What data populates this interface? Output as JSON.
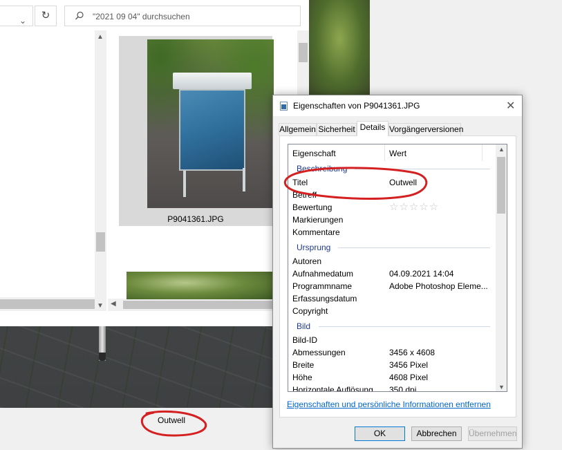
{
  "explorer": {
    "search_placeholder": "\"2021 09 04\" durchsuchen",
    "refresh_glyph": "↻",
    "chevron_glyph": "⌄",
    "thumbnail_caption": "P9041361.JPG"
  },
  "background_caption": "Outwell",
  "dialog": {
    "title": "Eigenschaften von P9041361.JPG",
    "close_glyph": "✕",
    "tabs": [
      {
        "label": "Allgemein"
      },
      {
        "label": "Sicherheit"
      },
      {
        "label": "Details"
      },
      {
        "label": "Vorgängerversionen"
      }
    ],
    "active_tab": "Details",
    "columns": {
      "property": "Eigenschaft",
      "value": "Wert"
    },
    "groups": {
      "description": "Beschreibung",
      "origin": "Ursprung",
      "image": "Bild"
    },
    "rows": {
      "titel": {
        "label": "Titel",
        "value": "Outwell"
      },
      "betreff": {
        "label": "Betreff"
      },
      "bewertung": {
        "label": "Bewertung",
        "stars": "☆☆☆☆☆",
        "rating": 0
      },
      "markierungen": {
        "label": "Markierungen"
      },
      "kommentare": {
        "label": "Kommentare"
      },
      "autoren": {
        "label": "Autoren"
      },
      "aufnahmedatum": {
        "label": "Aufnahmedatum",
        "value": "04.09.2021 14:04"
      },
      "programmname": {
        "label": "Programmname",
        "value": "Adobe Photoshop Eleme..."
      },
      "erfassungsdatum": {
        "label": "Erfassungsdatum"
      },
      "copyright": {
        "label": "Copyright"
      },
      "bild_id": {
        "label": "Bild-ID"
      },
      "abmessungen": {
        "label": "Abmessungen",
        "value": "3456 x 4608"
      },
      "breite": {
        "label": "Breite",
        "value": "3456 Pixel"
      },
      "hoehe": {
        "label": "Höhe",
        "value": "4608 Pixel"
      },
      "horizontale": {
        "label": "Horizontale Auflösung",
        "value": "350 dpi"
      }
    },
    "remove_link": "Eigenschaften und persönliche Informationen entfernen",
    "buttons": {
      "ok": "OK",
      "cancel": "Abbrechen",
      "apply": "Übernehmen"
    }
  },
  "colors": {
    "annotation": "#d42020",
    "link": "#0066cc",
    "group": "#1e3a8a"
  }
}
